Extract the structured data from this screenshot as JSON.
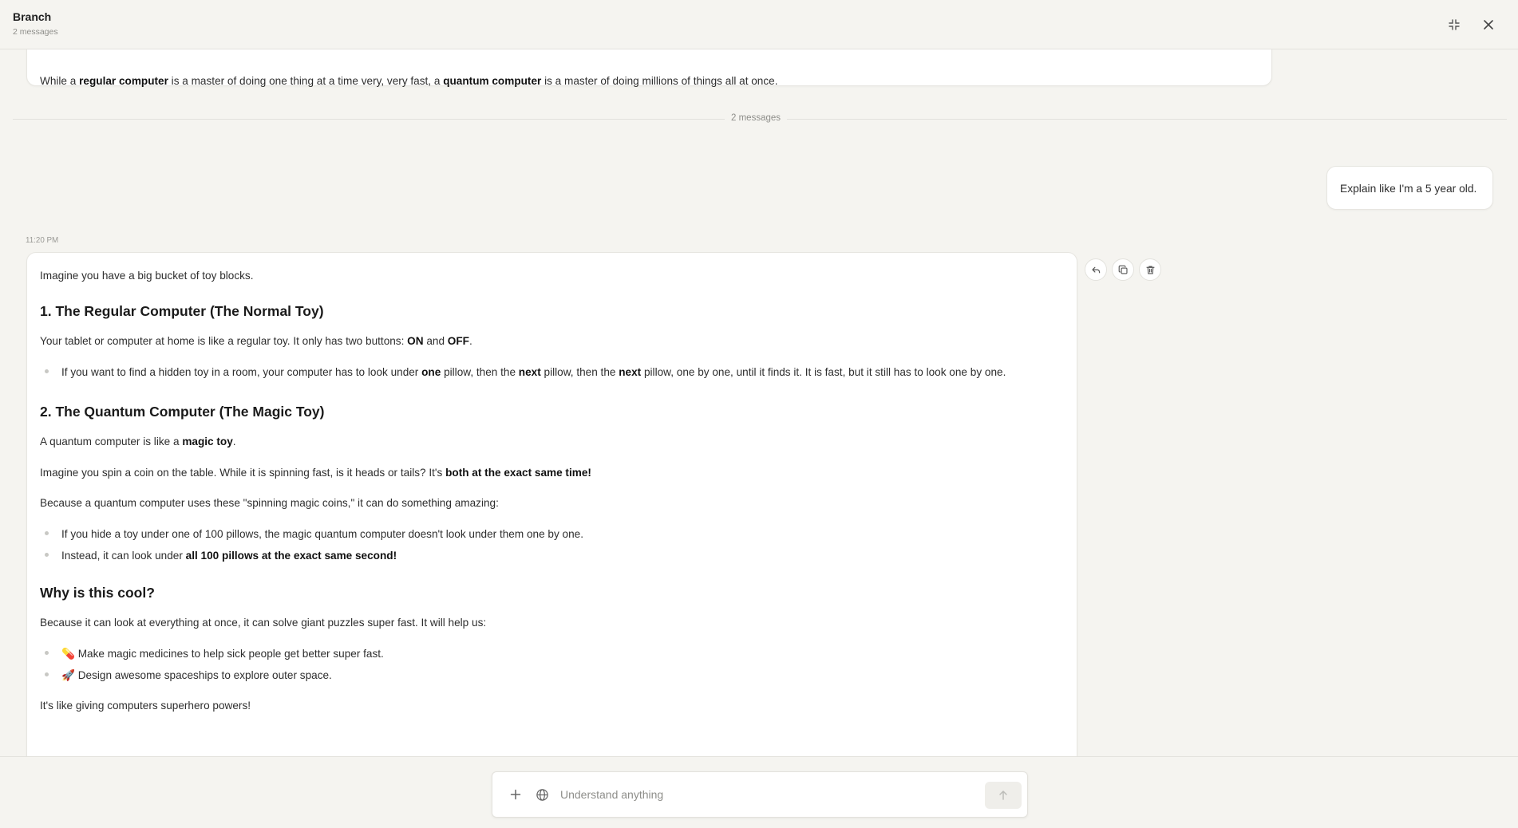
{
  "header": {
    "title": "Branch",
    "subtitle": "2 messages"
  },
  "previous_message": {
    "p1": "While a ",
    "b1": "regular computer",
    "p2": " is a master of doing one thing at a time very, very fast, a ",
    "b2": "quantum computer",
    "p3": " is a master of doing millions of things all at once."
  },
  "divider_label": "2 messages",
  "user_message": "Explain like I'm a 5 year old.",
  "timestamp": "11:20 PM",
  "answer": {
    "intro": "Imagine you have a big bucket of toy blocks.",
    "h1": "1. The Regular Computer (The Normal Toy)",
    "s1_p": {
      "t1": "Your tablet or computer at home is like a regular toy. It only has two buttons: ",
      "b1": "ON",
      "t2": " and ",
      "b2": "OFF",
      "t3": "."
    },
    "s1_li": {
      "t1": "If you want to find a hidden toy in a room, your computer has to look under ",
      "b1": "one",
      "t2": " pillow, then the ",
      "b2": "next",
      "t3": " pillow, then the ",
      "b3": "next",
      "t4": " pillow, one by one, until it finds it. It is fast, but it still has to look one by one."
    },
    "h2": "2. The Quantum Computer (The Magic Toy)",
    "s2_p1": {
      "t1": "A quantum computer is like a ",
      "b1": "magic toy",
      "t2": "."
    },
    "s2_p2": {
      "t1": "Imagine you spin a coin on the table. While it is spinning fast, is it heads or tails? It's ",
      "b1": "both at the exact same time!"
    },
    "s2_p3": "Because a quantum computer uses these \"spinning magic coins,\" it can do something amazing:",
    "s2_li1": "If you hide a toy under one of 100 pillows, the magic quantum computer doesn't look under them one by one.",
    "s2_li2": {
      "t1": "Instead, it can look under ",
      "b1": "all 100 pillows at the exact same second!"
    },
    "h3": "Why is this cool?",
    "s3_p": "Because it can look at everything at once, it can solve giant puzzles super fast. It will help us:",
    "s3_li1": {
      "emoji": "💊",
      "text": "Make magic medicines to help sick people get better super fast."
    },
    "s3_li2": {
      "emoji": "🚀",
      "text": "Design awesome spaceships to explore outer space."
    },
    "closing": "It's like giving computers superhero powers!"
  },
  "actions": {
    "reply_icon": "reply-icon",
    "copy_icon": "copy-icon",
    "delete_icon": "trash-icon"
  },
  "composer": {
    "placeholder": "Understand anything",
    "value": ""
  }
}
